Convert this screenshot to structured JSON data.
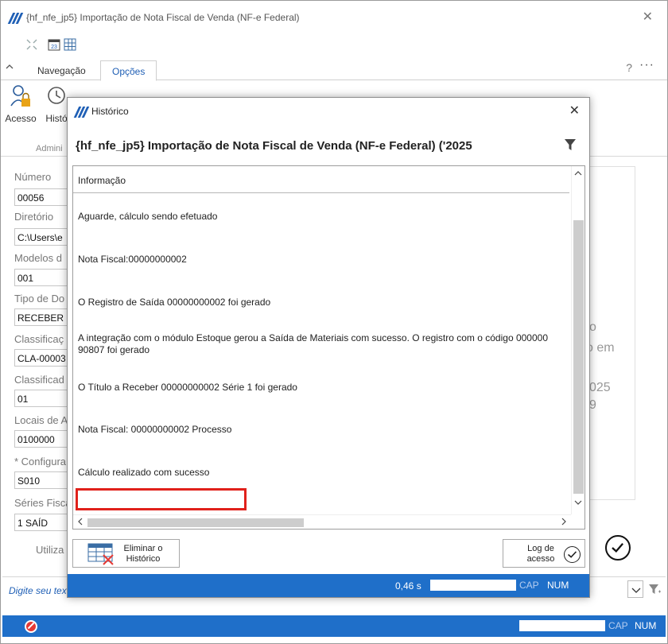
{
  "window": {
    "title": "{hf_nfe_jp5}  Importação de Nota Fiscal de Venda (NF-e Federal)",
    "close": "✕"
  },
  "ribbon": {
    "tabs": [
      {
        "label": "Navegação"
      },
      {
        "label": "Opções"
      }
    ],
    "help": "?",
    "more": "···",
    "items": [
      {
        "label": "Acesso"
      },
      {
        "label": "Histó"
      }
    ],
    "group_label": "Admini"
  },
  "form": {
    "fields": [
      {
        "label": "Número",
        "value": "00056"
      },
      {
        "label": "Diretório",
        "value": "C:\\Users\\e"
      },
      {
        "label": "Modelos d",
        "value": "001"
      },
      {
        "label": "Tipo de Do",
        "value": "RECEBER"
      },
      {
        "label": "Classificaç",
        "value": "CLA-00003"
      },
      {
        "label": "Classificad",
        "value": "01"
      },
      {
        "label": "Locais de A",
        "value": "0100000"
      },
      {
        "label": "* Configura",
        "value": "S010"
      },
      {
        "label": "Séries Fisca",
        "value": "1          SAÍD"
      }
    ],
    "utiliza": "Utiliza",
    "ghost_text": [
      "o",
      "o em",
      "025",
      "9"
    ]
  },
  "command_bar": {
    "placeholder": "Digite seu tex"
  },
  "status_bar": {
    "cap": "CAP",
    "num": "NUM"
  },
  "dialog": {
    "title": "Histórico",
    "close": "✕",
    "header_title": "{hf_nfe_jp5}  Importação de Nota Fiscal de Venda (NF-e Federal)  ('2025",
    "grid": {
      "column": "Informação",
      "rows": [
        {
          "text": "Aguarde, cálculo sendo efetuado"
        },
        {
          "text": "Nota Fiscal:00000000002"
        },
        {
          "text": "O Registro de Saída 00000000002 foi gerado"
        },
        {
          "text": "A integração com o módulo Estoque gerou a Saída de Materiais com sucesso. O registro com o código 000000",
          "line2": "90807 foi gerado"
        },
        {
          "text": "O Título a Receber 00000000002 Série 1 foi gerado"
        },
        {
          "text": "Nota Fiscal: 00000000002 Processo"
        },
        {
          "text": "Cálculo realizado com sucesso"
        }
      ]
    },
    "buttons": {
      "eliminar": {
        "line1": "Eliminar o",
        "line2": "Histórico"
      },
      "log": {
        "line1": "Log de",
        "line2": "acesso"
      }
    },
    "status": {
      "time": "0,46 s",
      "cap": "CAP",
      "num": "NUM"
    },
    "highlight_color": "#e0211b"
  },
  "colors": {
    "accent": "#1f6fc9",
    "link": "#1f5fb5"
  }
}
